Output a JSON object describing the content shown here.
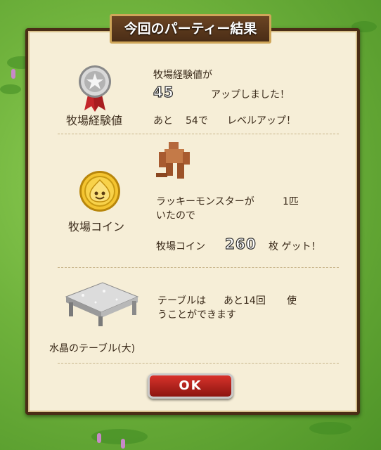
{
  "title": "今回のパーティー結果",
  "ranch_exp": {
    "label": "牧場経験値",
    "line1": "牧場経験値が",
    "value": "45",
    "line2": "アップしました！",
    "remaining_prefix": "あと",
    "remaining_value": "54で",
    "remaining_suffix": "レベルアップ！"
  },
  "ranch_coin": {
    "label": "牧場コイン",
    "line1a": "ラッキーモンスターが",
    "line1b": "1匹",
    "line2": "いたので",
    "earn_prefix": "牧場コイン",
    "value": "260",
    "earn_suffix": "枚 ゲット！"
  },
  "table_item": {
    "label": "水晶のテーブル(大)",
    "line1a": "テーブルは",
    "line1b": "あと14回",
    "line1c": "使",
    "line2": "うことができます"
  },
  "ok_label": "OK",
  "colors": {
    "frame": "#4a2d16",
    "panel": "#f6eed7",
    "ok_button": "#c62a22",
    "text": "#3a2a1a"
  }
}
